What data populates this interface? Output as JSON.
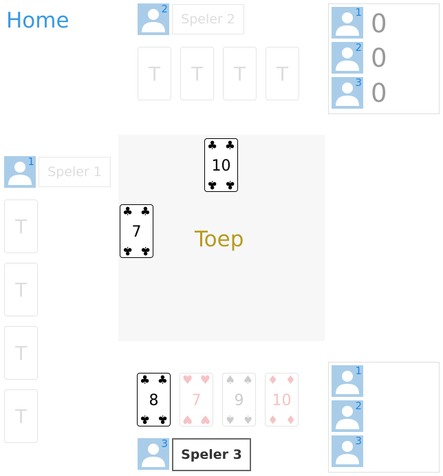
{
  "nav": {
    "home": "Home"
  },
  "game": {
    "title": "Toep"
  },
  "players": [
    {
      "number": "1",
      "name": "Speler 1"
    },
    {
      "number": "2",
      "name": "Speler 2"
    },
    {
      "number": "3",
      "name": "Speler 3"
    }
  ],
  "card_back_glyph": "T",
  "table_cards": [
    {
      "rank": "10",
      "suit": "♣",
      "color": "#000000"
    },
    {
      "rank": "7",
      "suit": "♣",
      "color": "#000000"
    }
  ],
  "hand": [
    {
      "rank": "8",
      "suit": "♣",
      "color": "#000000"
    },
    {
      "rank": "7",
      "suit": "♥",
      "color": "#f6c3c5"
    },
    {
      "rank": "9",
      "suit": "♠",
      "color": "#cccccc"
    },
    {
      "rank": "10",
      "suit": "♦",
      "color": "#f6c3c5"
    }
  ],
  "scoreboard": [
    {
      "player": "1",
      "score": "0"
    },
    {
      "player": "2",
      "score": "0"
    },
    {
      "player": "3",
      "score": "0"
    }
  ],
  "bottom_panel": [
    {
      "player": "1"
    },
    {
      "player": "2"
    },
    {
      "player": "3"
    }
  ],
  "colors": {
    "accent": "#3a9ae0",
    "title": "#b59b20",
    "avatar_bg": "#a9cde9"
  }
}
